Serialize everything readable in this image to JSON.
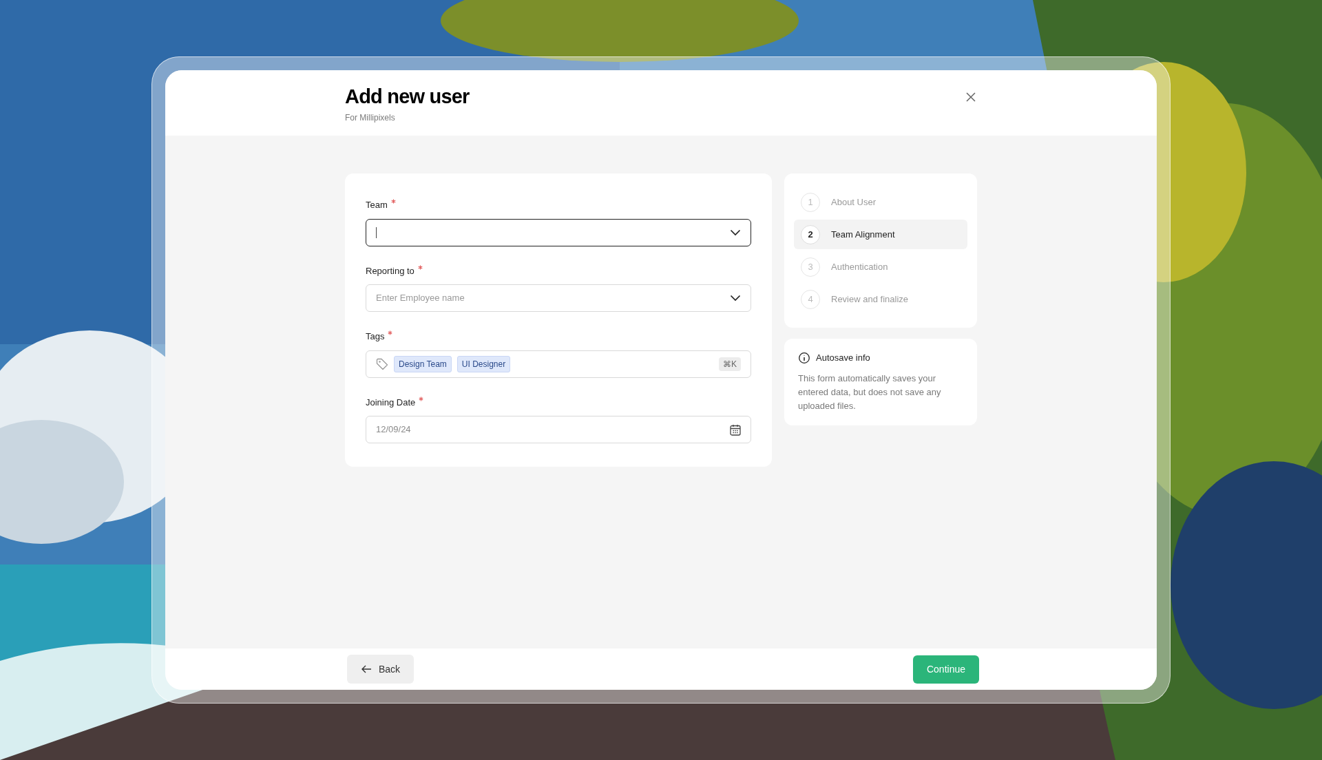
{
  "dialog": {
    "title": "Add new user",
    "subtitle": "For Millipixels"
  },
  "fields": [
    {
      "kind": "select",
      "label": "Team",
      "required": true,
      "focused": true
    },
    {
      "kind": "select",
      "label": "Reporting to",
      "required": true,
      "focused": false,
      "placeholder": "Enter Employee name"
    },
    {
      "kind": "tags",
      "label": "Tags",
      "required": true,
      "focused": false,
      "tags": [
        "Design Team",
        "UI Designer"
      ],
      "shortcut": "⌘K"
    },
    {
      "kind": "date",
      "label": "Joining Date",
      "required": true,
      "focused": false,
      "value": "12/09/24"
    }
  ],
  "steps": [
    {
      "number": "1",
      "label": "About User",
      "selected": false
    },
    {
      "number": "2",
      "label": "Team Alignment",
      "selected": true
    },
    {
      "number": "3",
      "label": "Authentication",
      "selected": false
    },
    {
      "number": "4",
      "label": "Review and finalize",
      "selected": false
    }
  ],
  "info": {
    "title": "Autosave info",
    "text": "This form automatically saves your entered data, but does not save any uploaded files."
  },
  "footer": {
    "back": "Back",
    "continue": "Continue"
  }
}
